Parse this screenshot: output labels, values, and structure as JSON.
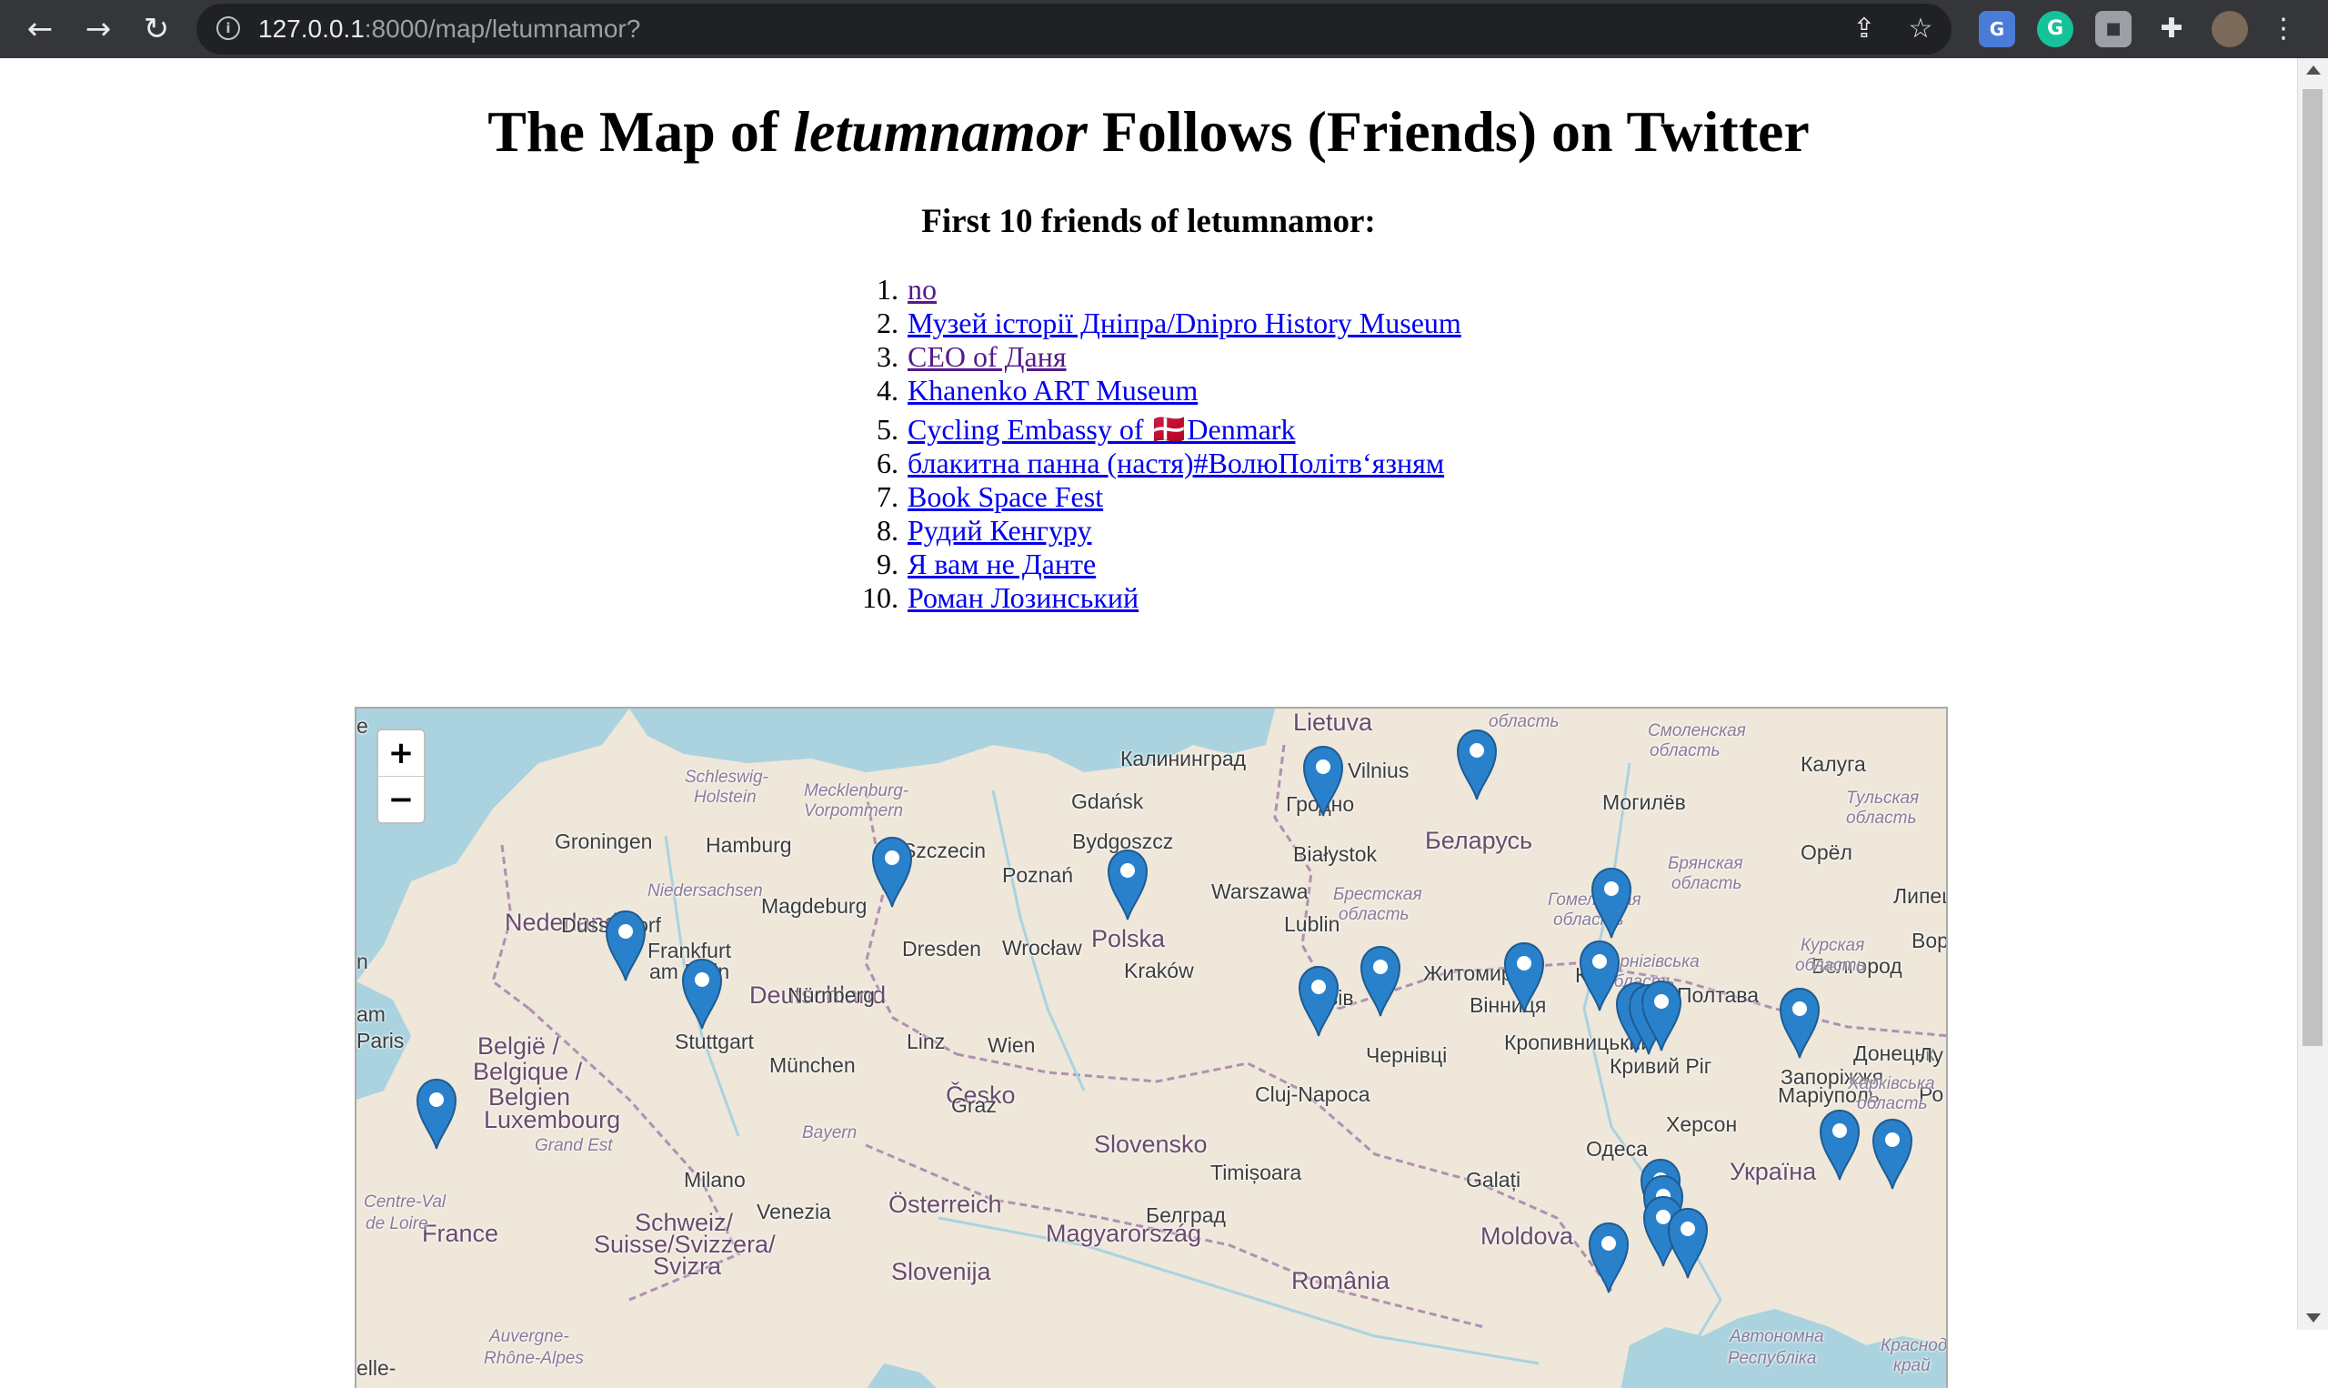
{
  "browser": {
    "url_host": "127.0.0.1",
    "url_path": ":8000/map/letumnamor?",
    "icons": [
      "back-icon",
      "forward-icon",
      "reload-icon",
      "info-icon",
      "share-icon",
      "star-icon",
      "google-translate-icon",
      "grammarly-icon",
      "extension-icon",
      "puzzle-icon",
      "avatar",
      "menu-icon"
    ]
  },
  "page": {
    "title_prefix": "The Map of ",
    "title_user": "letumnamor",
    "title_suffix": " Follows (Friends) on Twitter",
    "subtitle": "First 10 friends of letumnamor:",
    "friends": [
      {
        "num": "1.",
        "name": "no",
        "visited": true
      },
      {
        "num": "2.",
        "name": "Музей історії Дніпра/Dnipro History Museum",
        "visited": false
      },
      {
        "num": "3.",
        "name": "CEO of Даня",
        "visited": true
      },
      {
        "num": "4.",
        "name": "Khanenko ART Museum",
        "visited": false
      },
      {
        "num": "5.",
        "name": "Cycling Embassy of 🇩🇰Denmark",
        "visited": false
      },
      {
        "num": "6.",
        "name": "блакитна панна (настя)#ВолюПолітв‘язням",
        "visited": false
      },
      {
        "num": "7.",
        "name": "Book Space Fest",
        "visited": false
      },
      {
        "num": "8.",
        "name": "Рудий Кенгуру",
        "visited": false
      },
      {
        "num": "9.",
        "name": "Я вам не Данте",
        "visited": false
      },
      {
        "num": "10.",
        "name": "Роман Лозинський",
        "visited": false
      }
    ]
  },
  "map": {
    "zoom_in": "+",
    "zoom_out": "−",
    "colors": {
      "land": "#eee7da",
      "water": "#aad3df",
      "marker": "#2a81cb",
      "border": "#b18fb1"
    },
    "labels": {
      "country": [
        "Nederland",
        "Deutschland",
        "Polska",
        "Беларусь",
        "Україна",
        "Česko",
        "Slovensko",
        "Österreich",
        "Magyarország",
        "România",
        "Moldova",
        "France",
        "Luxembourg",
        "Schweiz/",
        "Suisse/Svizzera/",
        "Svizra",
        "Slovenija",
        "België /",
        "Belgique /",
        "Belgien",
        "Lietuva"
      ],
      "city": [
        "Groningen",
        "Hamburg",
        "Gdańsk",
        "Калининград",
        "Vilnius",
        "Гродно",
        "Могилёв",
        "Калуга",
        "Szczecin",
        "Bydgoszcz",
        "Białystok",
        "Орёл",
        "Poznań",
        "Warszawa",
        "Magdeburg",
        "Lublin",
        "Wrocław",
        "Dresden",
        "Kraków",
        "Львів",
        "Житомир",
        "Київ",
        "Düsseldorf",
        "Frankfurt",
        "am Main",
        "Nürnberg",
        "Полтава",
        "Белгород",
        "Вінниця",
        "Stuttgart",
        "Linz",
        "Wien",
        "Кропивницький",
        "Донецьк",
        "München",
        "Чернівці",
        "Кривий Ріг",
        "Запоріжжя",
        "Graz",
        "Cluj-Napoca",
        "Маріуполь",
        "Херсон",
        "Одеса",
        "Milano",
        "Venezia",
        "Timișoara",
        "Galați",
        "Белград",
        "Paris",
        "Липец",
        "Вор",
        "Лу",
        "Ро",
        "Кривий",
        "Ріг",
        "Кра",
        "Рі"
      ],
      "region": [
        "область",
        "Смоленская",
        "область",
        "Тульская",
        "область",
        "Schleswig-",
        "Holstein",
        "Mecklenburg-",
        "Vorpommern",
        "Брянская",
        "область",
        "Niedersachsen",
        "Брестская",
        "область",
        "Гомельская",
        "область",
        "Чернігівська",
        "область",
        "Курская",
        "область",
        "Bayern",
        "Харківська",
        "область",
        "Grand Est",
        "Centre-Val",
        "de Loire",
        "Auvergne-",
        "Rhône-Alpes",
        "Автономна",
        "Республіка",
        "Краснодарский",
        "край"
      ],
      "edge": [
        "am",
        "n",
        "e",
        "elle-"
      ]
    }
  }
}
